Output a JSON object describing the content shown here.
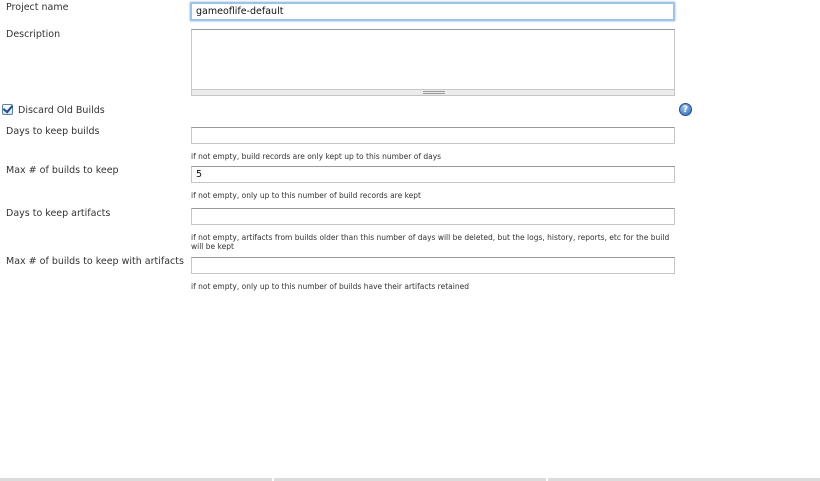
{
  "project": {
    "name_label": "Project name",
    "name_value": "gameoflife-default",
    "description_label": "Description",
    "description_value": ""
  },
  "discard": {
    "label": "Discard Old Builds",
    "checked": true,
    "help_icon": "?"
  },
  "fields": {
    "days_builds": {
      "label": "Days to keep builds",
      "value": "",
      "hint": "if not empty, build records are only kept up to this number of days"
    },
    "max_builds": {
      "label": "Max # of builds to keep",
      "value": "5",
      "hint": "if not empty, only up to this number of build records are kept"
    },
    "days_artifacts": {
      "label": "Days to keep artifacts",
      "value": "",
      "hint": "if not empty, artifacts from builds older than this number of days will be deleted, but the logs, history, reports, etc for the build will be kept"
    },
    "max_artifacts": {
      "label": "Max # of builds to keep with artifacts",
      "value": "",
      "hint": "if not empty, only up to this number of builds have their artifacts retained"
    }
  }
}
